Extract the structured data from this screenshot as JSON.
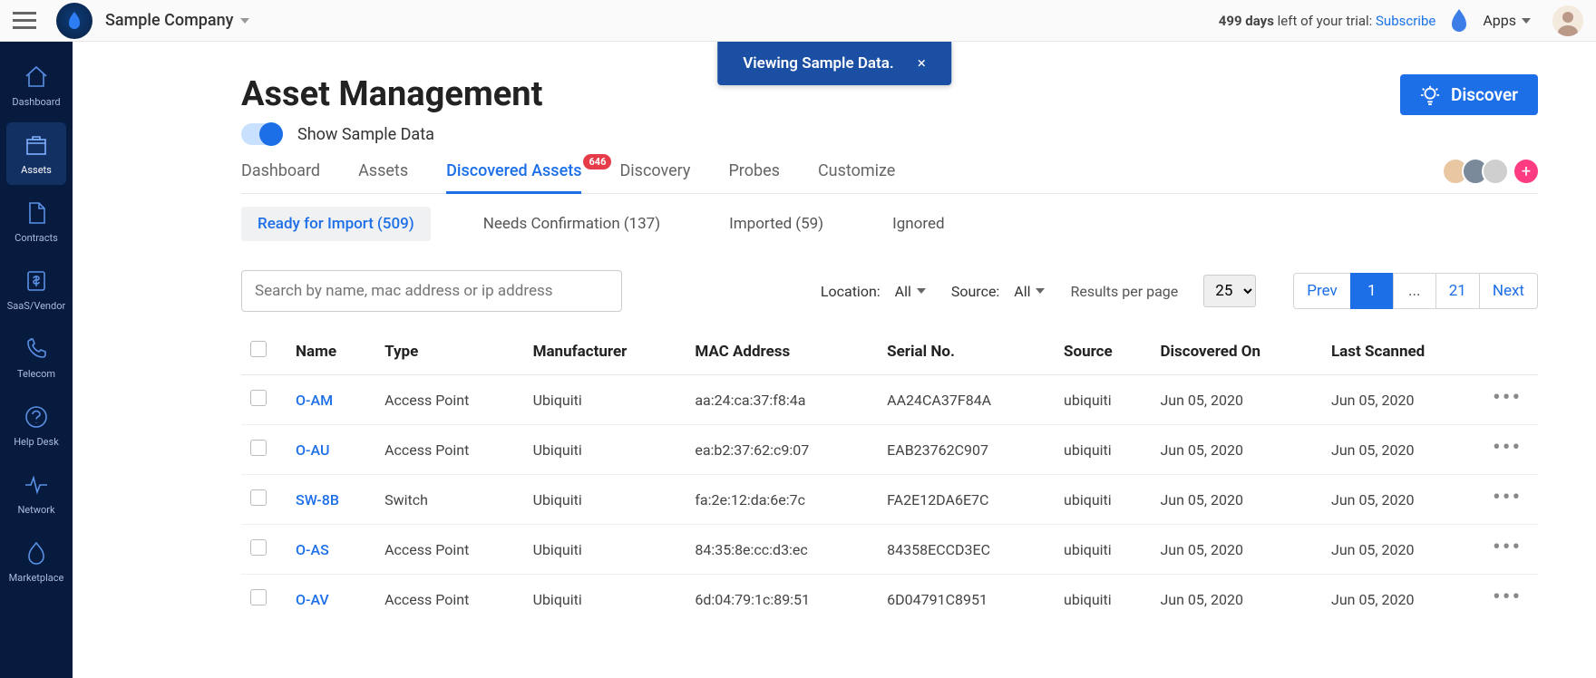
{
  "top": {
    "company": "Sample Company",
    "trial_days": "499 days",
    "trial_rest": " left of your trial: ",
    "subscribe": "Subscribe",
    "apps": "Apps"
  },
  "sidebar": {
    "items": [
      {
        "label": "Dashboard",
        "icon": "home"
      },
      {
        "label": "Assets",
        "icon": "box",
        "active": true
      },
      {
        "label": "Contracts",
        "icon": "doc"
      },
      {
        "label": "SaaS/Vendor",
        "icon": "dollar"
      },
      {
        "label": "Telecom",
        "icon": "phone"
      },
      {
        "label": "Help Desk",
        "icon": "help"
      },
      {
        "label": "Network",
        "icon": "pulse"
      },
      {
        "label": "Marketplace",
        "icon": "flame"
      }
    ]
  },
  "banner": {
    "text": "Viewing Sample Data.",
    "close": "×"
  },
  "page": {
    "title": "Asset Management",
    "toggle_label": "Show Sample Data",
    "discover": "Discover"
  },
  "tabs": [
    {
      "label": "Dashboard"
    },
    {
      "label": "Assets"
    },
    {
      "label": "Discovered Assets",
      "badge": "646",
      "active": true
    },
    {
      "label": "Discovery"
    },
    {
      "label": "Probes"
    },
    {
      "label": "Customize"
    }
  ],
  "subtabs": [
    {
      "label": "Ready for Import",
      "count": "(509)",
      "active": true
    },
    {
      "label": "Needs Confirmation",
      "count": "(137)"
    },
    {
      "label": "Imported",
      "count": "(59)"
    },
    {
      "label": "Ignored",
      "count": ""
    }
  ],
  "filters": {
    "search_placeholder": "Search by name, mac address or ip address",
    "location_label": "Location:",
    "location_value": "All",
    "source_label": "Source:",
    "source_value": "All",
    "rpp_label": "Results per page",
    "rpp_value": "25"
  },
  "pager": {
    "prev": "Prev",
    "current": "1",
    "dots": "...",
    "last_num": "21",
    "next": "Next"
  },
  "columns": [
    "Name",
    "Type",
    "Manufacturer",
    "MAC Address",
    "Serial No.",
    "Source",
    "Discovered On",
    "Last Scanned"
  ],
  "rows": [
    {
      "name": "O-AM",
      "type": "Access Point",
      "manufacturer": "Ubiquiti",
      "mac": "aa:24:ca:37:f8:4a",
      "serial": "AA24CA37F84A",
      "source": "ubiquiti",
      "discovered": "Jun 05, 2020",
      "scanned": "Jun 05, 2020"
    },
    {
      "name": "O-AU",
      "type": "Access Point",
      "manufacturer": "Ubiquiti",
      "mac": "ea:b2:37:62:c9:07",
      "serial": "EAB23762C907",
      "source": "ubiquiti",
      "discovered": "Jun 05, 2020",
      "scanned": "Jun 05, 2020"
    },
    {
      "name": "SW-8B",
      "type": "Switch",
      "manufacturer": "Ubiquiti",
      "mac": "fa:2e:12:da:6e:7c",
      "serial": "FA2E12DA6E7C",
      "source": "ubiquiti",
      "discovered": "Jun 05, 2020",
      "scanned": "Jun 05, 2020"
    },
    {
      "name": "O-AS",
      "type": "Access Point",
      "manufacturer": "Ubiquiti",
      "mac": "84:35:8e:cc:d3:ec",
      "serial": "84358ECCD3EC",
      "source": "ubiquiti",
      "discovered": "Jun 05, 2020",
      "scanned": "Jun 05, 2020"
    },
    {
      "name": "O-AV",
      "type": "Access Point",
      "manufacturer": "Ubiquiti",
      "mac": "6d:04:79:1c:89:51",
      "serial": "6D04791C8951",
      "source": "ubiquiti",
      "discovered": "Jun 05, 2020",
      "scanned": "Jun 05, 2020"
    }
  ]
}
